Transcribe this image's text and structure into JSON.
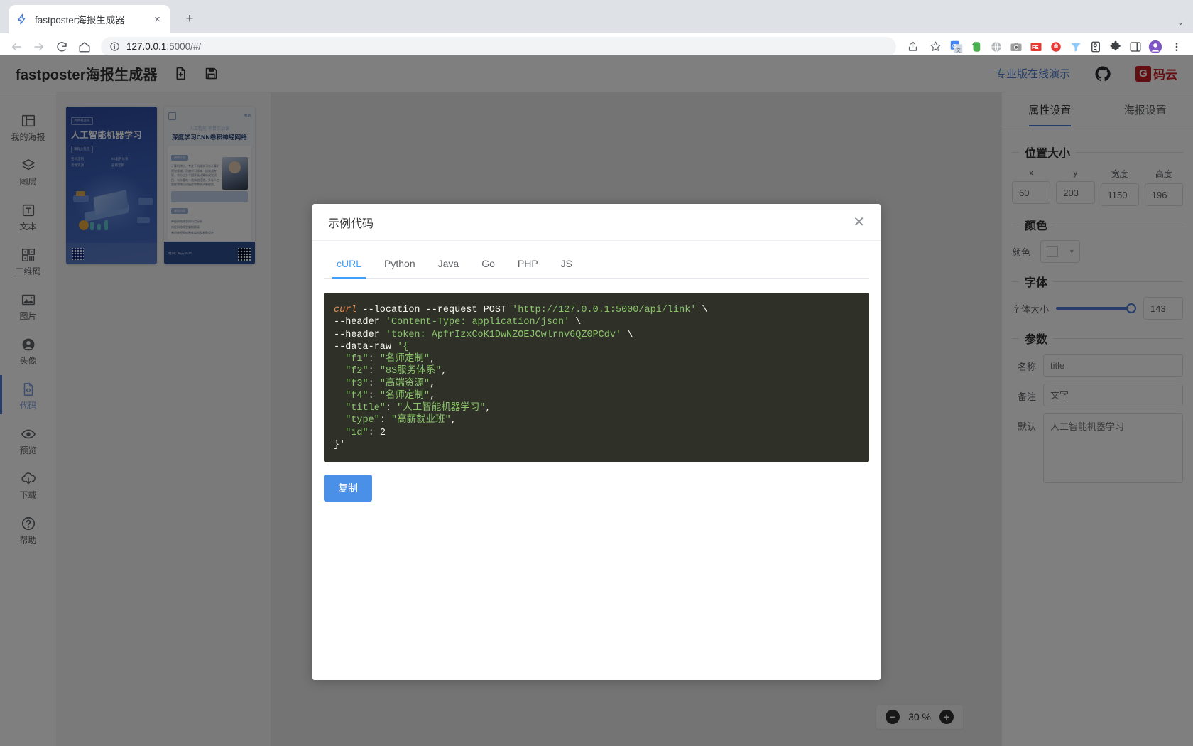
{
  "browser": {
    "tab": {
      "title": "fastposter海报生成器",
      "favicon": "lightning-icon",
      "close": "×"
    },
    "new_tab": "+",
    "nav": {
      "back": "←",
      "forward": "→",
      "reload": "⟳",
      "home": "⌂"
    },
    "omnibox": {
      "host": "127.0.0.1",
      "rest": ":5000/#/",
      "info_icon": "info-icon"
    },
    "actions": {
      "share": "share-icon",
      "bookmark": "star-icon"
    },
    "extensions": [
      "translate-icon",
      "evernote-icon",
      "globe-icon",
      "camera-icon",
      "fe-icon",
      "adblock-icon",
      "funnel-icon",
      "pocket-icon",
      "puzzle-icon"
    ],
    "window_controls": {
      "collapse": "⌄"
    },
    "sidepanel_icon": "sidepanel-icon",
    "profile_icon": "profile-avatar",
    "menu_icon": "three-dot-menu"
  },
  "app": {
    "logo": "fastposter海报生成器",
    "header_icons": [
      "new-file-icon",
      "save-icon"
    ],
    "pro_link": "专业版在线演示",
    "github": "github-icon",
    "gitee": {
      "mark": "G",
      "label": "码云"
    }
  },
  "sidebar": {
    "items": [
      {
        "label": "我的海报",
        "icon": "layout-icon",
        "active": false
      },
      {
        "label": "图层",
        "icon": "layers-icon",
        "active": false
      },
      {
        "label": "文本",
        "icon": "text-icon",
        "active": false
      },
      {
        "label": "二维码",
        "icon": "qrcode-icon",
        "active": false
      },
      {
        "label": "图片",
        "icon": "image-icon",
        "active": false
      },
      {
        "label": "头像",
        "icon": "avatar-icon",
        "active": false
      },
      {
        "label": "代码",
        "icon": "code-file-icon",
        "active": true
      },
      {
        "label": "预览",
        "icon": "eye-icon",
        "active": false
      },
      {
        "label": "下载",
        "icon": "download-cloud-icon",
        "active": false
      },
      {
        "label": "帮助",
        "icon": "help-icon",
        "active": false
      }
    ]
  },
  "posters": [
    {
      "name": "poster-ai-ml",
      "tag": "高薪就业班",
      "title": "人工智能机器学习",
      "tag2": "课程大礼包",
      "features": [
        "名师定制",
        "8S服务体系",
        "高端资源",
        "名师定制"
      ]
    },
    {
      "name": "poster-cnn",
      "eyebrow": "人工智能·项目实战课",
      "title": "深度学习CNN卷积神经网络",
      "pill": "讲师介绍",
      "bio": "计算机博士，专注于机器学习与计算机视觉领域，深度学习领域一线实战专家，参与过多个国家级计算机视觉项目，有丰富的一线实战经验，多年人工智能领域培训经验和教学讲解经验。",
      "section": "课程内容",
      "list": [
        "神经网络模型知识点分析",
        "神经网络模型架构解读",
        "卷积神经网络整体架构及参数设计"
      ],
      "footer": "时间：每天20:00"
    }
  ],
  "right_panel": {
    "tabs": [
      {
        "label": "属性设置",
        "active": true
      },
      {
        "label": "海报设置",
        "active": false
      }
    ],
    "sections": {
      "position_size": {
        "legend": "位置大小",
        "fields": [
          {
            "label": "x",
            "value": "60"
          },
          {
            "label": "y",
            "value": "203"
          },
          {
            "label": "宽度",
            "value": "1150"
          },
          {
            "label": "高度",
            "value": "196"
          }
        ]
      },
      "color": {
        "legend": "颜色",
        "label": "颜色",
        "swatch": "#ffffff"
      },
      "font": {
        "legend": "字体",
        "label": "字体大小",
        "value": "143",
        "slider_percent": 88
      },
      "params": {
        "legend": "参数",
        "rows": [
          {
            "label": "名称",
            "value": "title"
          },
          {
            "label": "备注",
            "value": "文字"
          },
          {
            "label": "默认",
            "value": "人工智能机器学习"
          }
        ]
      }
    }
  },
  "zoom_control": {
    "minus": "−",
    "value": "30 %",
    "plus": "+"
  },
  "modal": {
    "title": "示例代码",
    "close": "✕",
    "tabs": [
      {
        "label": "cURL",
        "active": true
      },
      {
        "label": "Python",
        "active": false
      },
      {
        "label": "Java",
        "active": false
      },
      {
        "label": "Go",
        "active": false
      },
      {
        "label": "PHP",
        "active": false
      },
      {
        "label": "JS",
        "active": false
      }
    ],
    "copy_button": "复制",
    "code": {
      "command": "curl",
      "line1_flags": " --location --request POST ",
      "line1_url": "'http://127.0.0.1:5000/api/link'",
      "line2_flag": "--header ",
      "line2_val": "'Content-Type: application/json'",
      "line3_flag": "--header ",
      "line3_val": "'token: ApfrIzxCoK1DwNZOEJCwlrnv6QZ0PCdv'",
      "line4_flag": "--data-raw ",
      "line4_val": "'{",
      "body": [
        {
          "key": "\"f1\"",
          "value": "\"名师定制\"",
          "comma": ","
        },
        {
          "key": "\"f2\"",
          "value": "\"8S服务体系\"",
          "comma": ","
        },
        {
          "key": "\"f3\"",
          "value": "\"高端资源\"",
          "comma": ","
        },
        {
          "key": "\"f4\"",
          "value": "\"名师定制\"",
          "comma": ","
        },
        {
          "key": "\"title\"",
          "value": "\"人工智能机器学习\"",
          "comma": ","
        },
        {
          "key": "\"type\"",
          "value": "\"高薪就业班\"",
          "comma": ","
        },
        {
          "key": "\"id\"",
          "value": "2",
          "comma": ""
        }
      ],
      "closing": "}'",
      "continuation": "\\"
    }
  }
}
